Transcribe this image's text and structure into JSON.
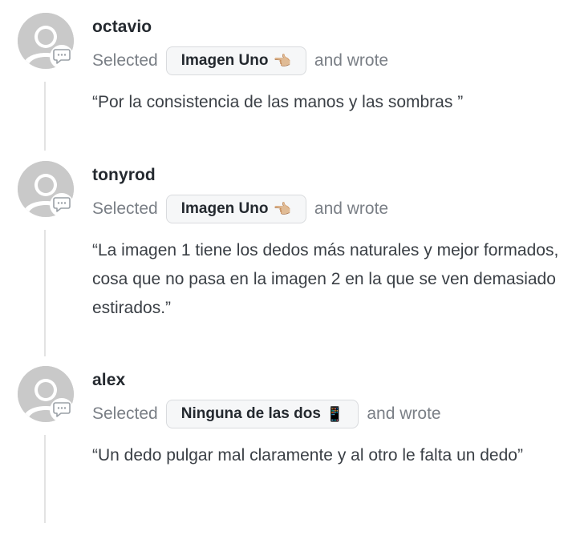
{
  "comments": [
    {
      "username": "octavio",
      "selected_prefix": "Selected",
      "choice_label": "Imagen Uno",
      "choice_emoji": "👈🏼",
      "wrote_suffix": "and wrote",
      "text": "“Por la consistencia de las manos y las sombras ”"
    },
    {
      "username": "tonyrod",
      "selected_prefix": "Selected",
      "choice_label": "Imagen Uno",
      "choice_emoji": "👈🏼",
      "wrote_suffix": "and wrote",
      "text": "“La imagen 1 tiene los dedos más naturales y mejor formados, cosa que no pasa en la imagen 2 en la que se ven demasiado estirados.”"
    },
    {
      "username": "alex",
      "selected_prefix": "Selected",
      "choice_label": "Ninguna de las dos",
      "choice_emoji": "📱",
      "wrote_suffix": "and wrote",
      "text": "“Un dedo pulgar mal claramente y al otro le falta un dedo”"
    }
  ],
  "icons": {
    "avatar": "default-user-avatar-icon",
    "comment": "comment-bubble-icon"
  },
  "colors": {
    "avatar_gray": "#c9c9c9",
    "muted_text": "#7a7f86",
    "chip_bg": "#f6f7f8",
    "chip_border": "#d9dbde",
    "thread_line": "#e3e3e3"
  }
}
